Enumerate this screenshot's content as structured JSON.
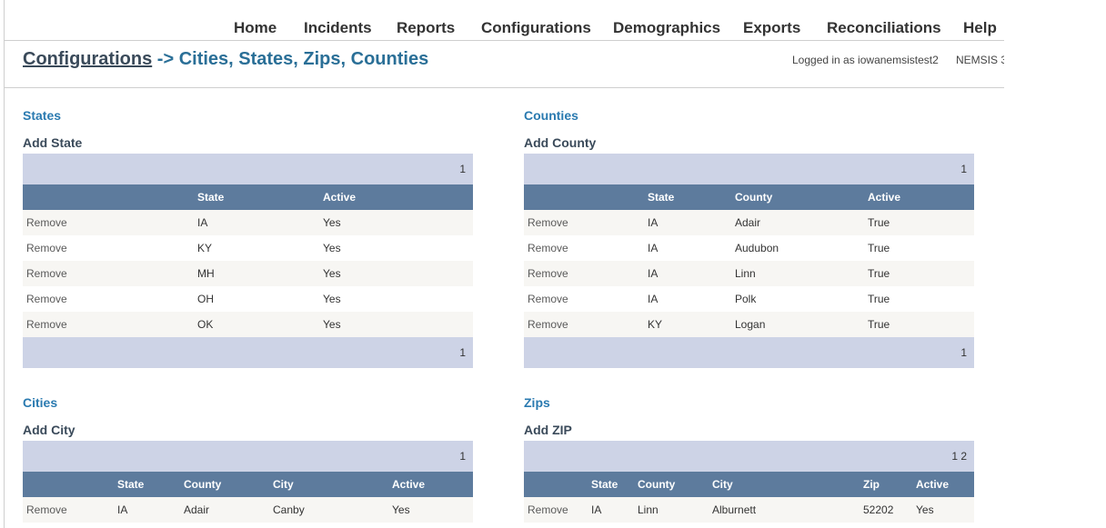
{
  "nav": {
    "items": [
      "Home",
      "Incidents",
      "Reports",
      "Configurations",
      "Demographics",
      "Exports",
      "Reconciliations",
      "Help"
    ]
  },
  "header": {
    "crumb": "Configurations",
    "separator": "->",
    "title": "Cities, States, Zips, Counties",
    "login": "Logged in as iowanemsistest2",
    "version": "NEMSIS 3"
  },
  "states": {
    "title": "States",
    "add_label": "Add State",
    "pager_top": "1",
    "pager_bottom": "1",
    "remove_label": "Remove",
    "columns": [
      "",
      "State",
      "Active"
    ],
    "rows": [
      [
        "IA",
        "Yes"
      ],
      [
        "KY",
        "Yes"
      ],
      [
        "MH",
        "Yes"
      ],
      [
        "OH",
        "Yes"
      ],
      [
        "OK",
        "Yes"
      ]
    ]
  },
  "counties": {
    "title": "Counties",
    "add_label": "Add County",
    "pager_top": "1",
    "pager_bottom": "1",
    "remove_label": "Remove",
    "columns": [
      "",
      "State",
      "County",
      "Active"
    ],
    "rows": [
      [
        "IA",
        "Adair",
        "True"
      ],
      [
        "IA",
        "Audubon",
        "True"
      ],
      [
        "IA",
        "Linn",
        "True"
      ],
      [
        "IA",
        "Polk",
        "True"
      ],
      [
        "KY",
        "Logan",
        "True"
      ]
    ]
  },
  "cities": {
    "title": "Cities",
    "add_label": "Add City",
    "pager_top": "1",
    "remove_label": "Remove",
    "columns": [
      "",
      "State",
      "County",
      "City",
      "Active"
    ],
    "rows": [
      [
        "IA",
        "Adair",
        "Canby",
        "Yes"
      ]
    ]
  },
  "zips": {
    "title": "Zips",
    "add_label": "Add ZIP",
    "pager_top": "1 2",
    "remove_label": "Remove",
    "columns": [
      "",
      "State",
      "County",
      "City",
      "Zip",
      "Active"
    ],
    "rows": [
      [
        "IA",
        "Linn",
        "Alburnett",
        "52202",
        "Yes"
      ]
    ]
  }
}
